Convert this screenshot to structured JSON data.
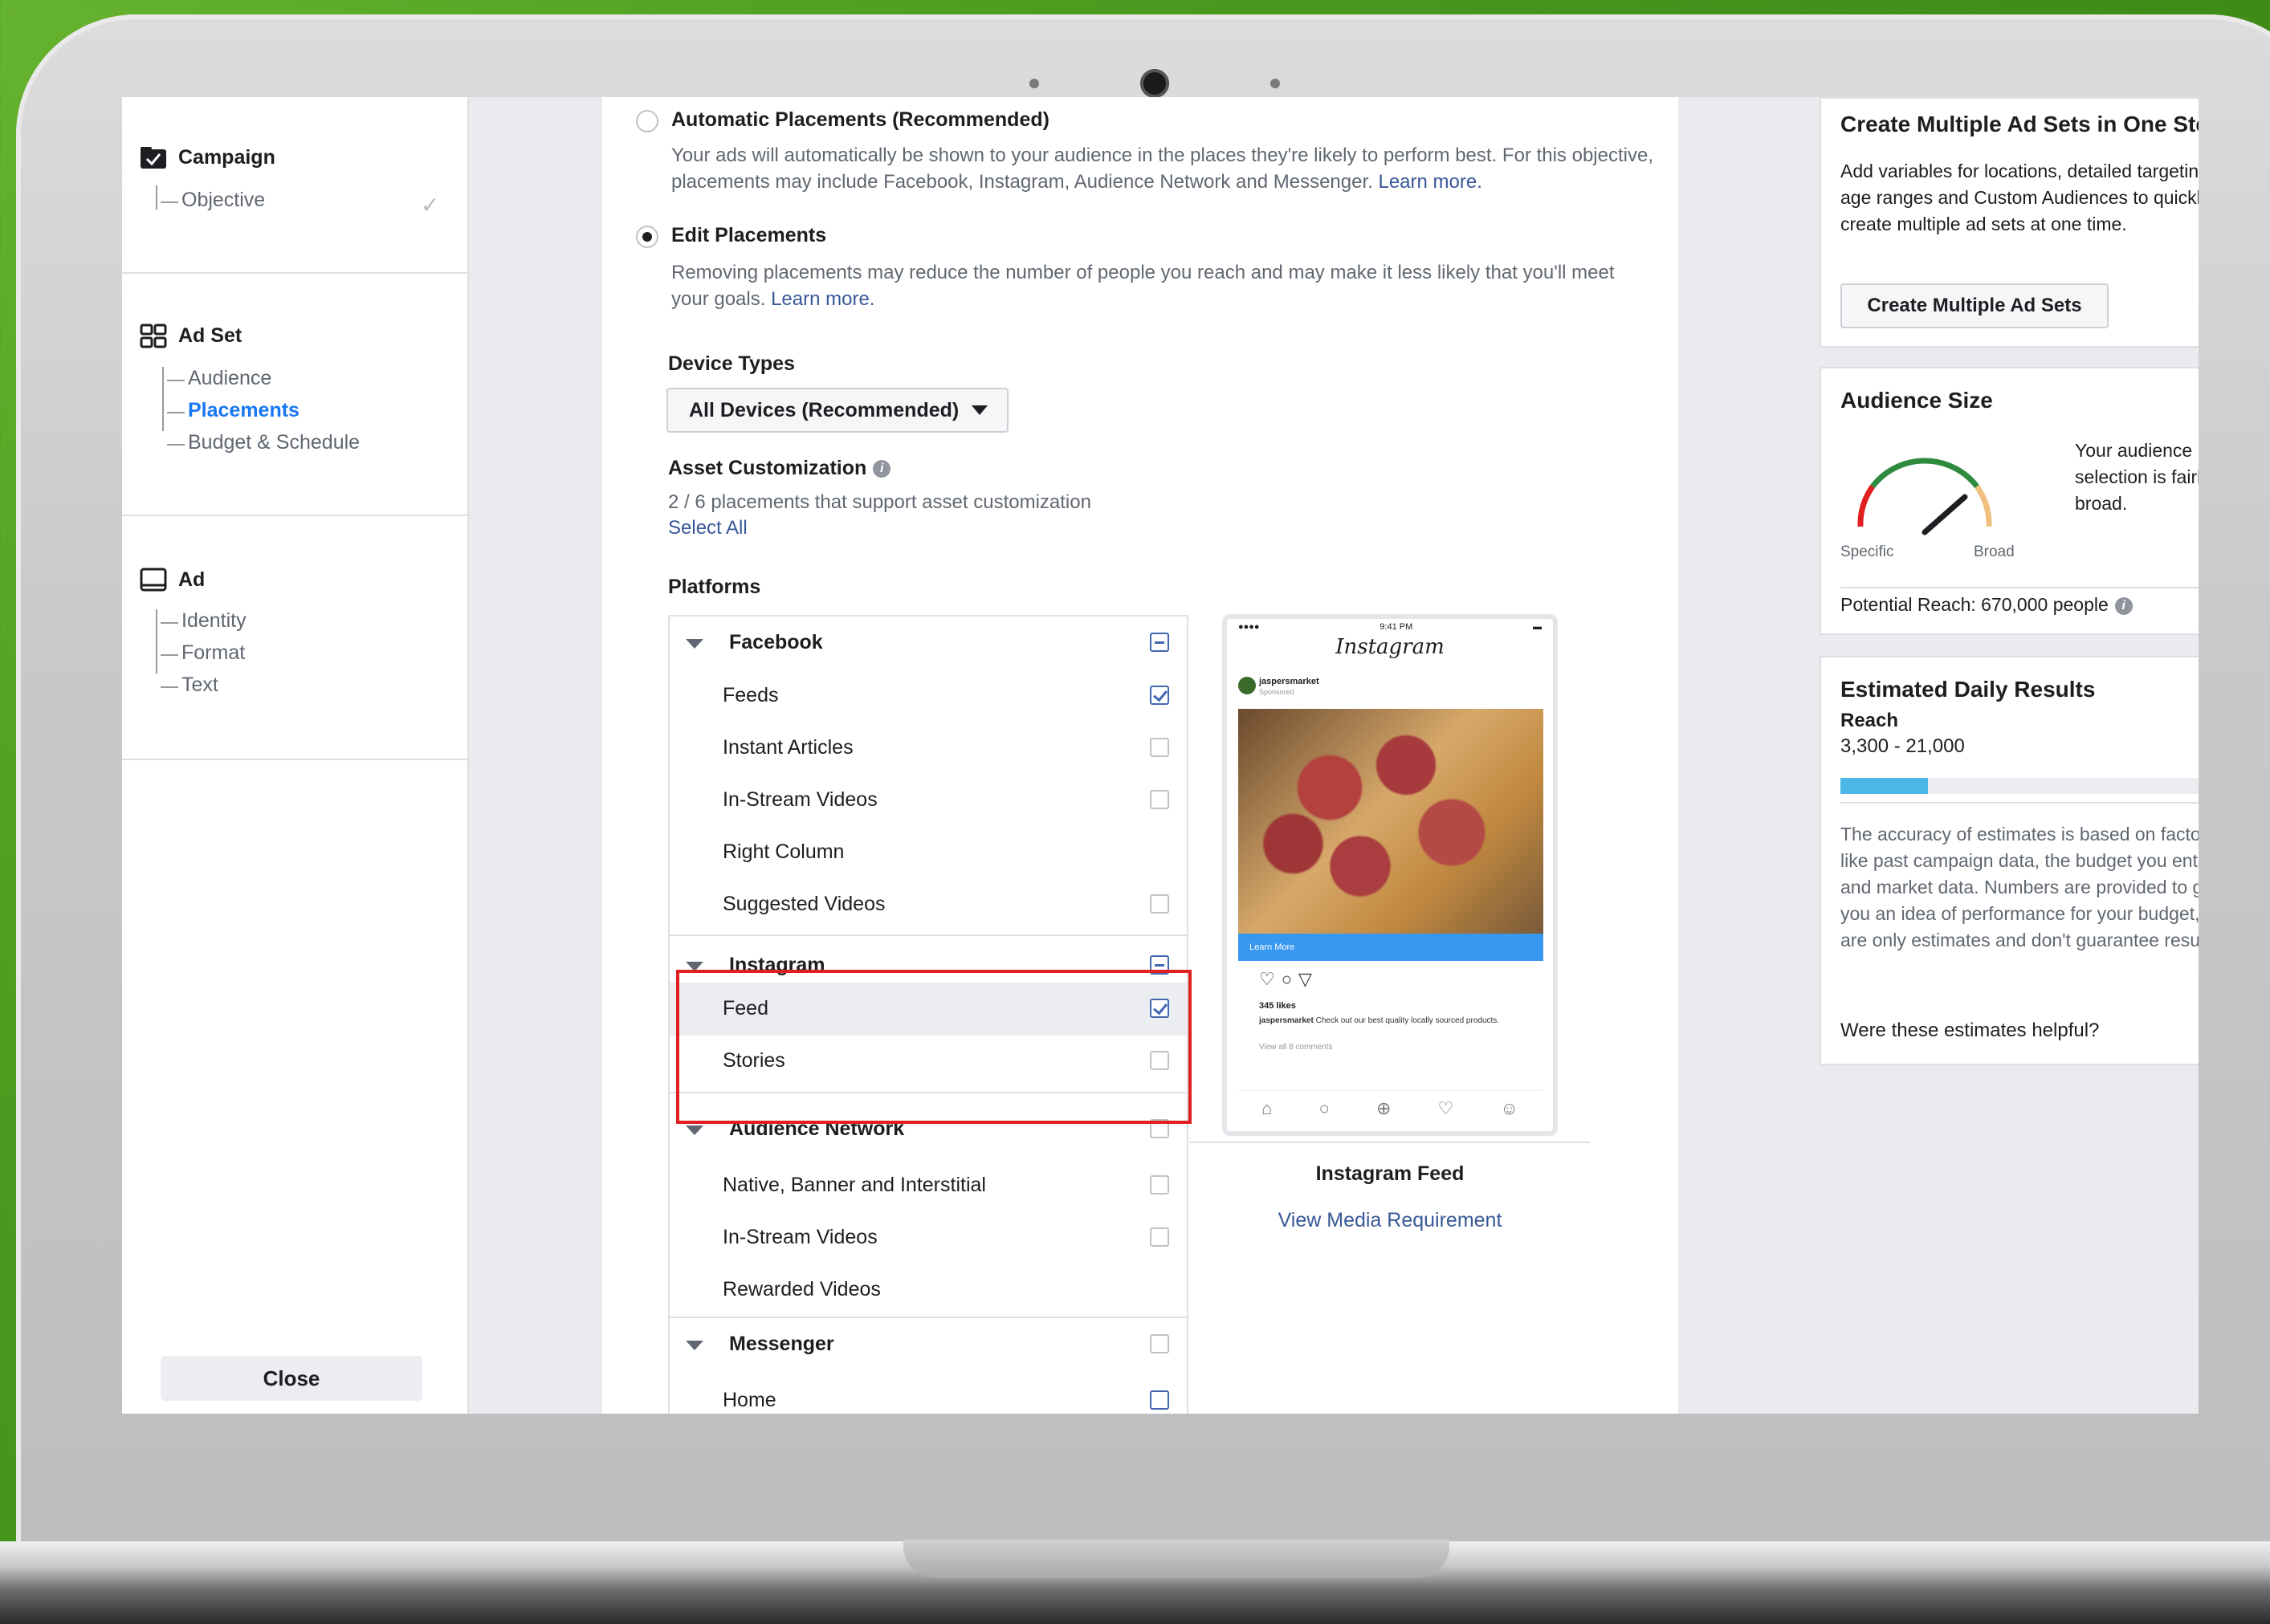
{
  "sidebar": {
    "campaign": {
      "title": "Campaign",
      "items": [
        "Objective"
      ]
    },
    "ad_set": {
      "title": "Ad Set",
      "items": [
        "Audience",
        "Placements",
        "Budget & Schedule"
      ],
      "active_index": 1
    },
    "ad": {
      "title": "Ad",
      "items": [
        "Identity",
        "Format",
        "Text"
      ]
    },
    "close_label": "Close"
  },
  "placements": {
    "automatic": {
      "label": "Automatic Placements (Recommended)",
      "desc": "Your ads will automatically be shown to your audience in the places they're likely to perform best. For this objective, placements may include Facebook, Instagram, Audience Network and Messenger.",
      "link": "Learn more."
    },
    "edit": {
      "label": "Edit Placements",
      "desc": "Removing placements may reduce the number of people you reach and may make it less likely that you'll meet your goals.",
      "link": "Learn more."
    },
    "selected": "edit",
    "device_types_label": "Device Types",
    "device_types_value": "All Devices (Recommended)",
    "asset_custom_label": "Asset Customization",
    "asset_custom_desc": "2 / 6 placements that support asset customization",
    "select_all": "Select All",
    "platforms_label": "Platforms"
  },
  "platforms": {
    "facebook": {
      "label": "Facebook",
      "items": [
        "Feeds",
        "Instant Articles",
        "In-Stream Videos",
        "Right Column",
        "Suggested Videos"
      ]
    },
    "instagram": {
      "label": "Instagram",
      "items": [
        "Feed",
        "Stories"
      ]
    },
    "audience_network": {
      "label": "Audience Network",
      "items": [
        "Native, Banner and Interstitial",
        "In-Stream Videos",
        "Rewarded Videos"
      ]
    },
    "messenger": {
      "label": "Messenger",
      "items": [
        "Home"
      ]
    }
  },
  "preview": {
    "status_time": "9:41 PM",
    "app": "Instagram",
    "user": "jaspersmarket",
    "sponsored": "Sponsored",
    "cta": "Learn More",
    "likes": "345 likes",
    "caption_user": "jaspersmarket",
    "caption": "Check out our best quality locally sourced products.",
    "comments": "View all 8 comments",
    "title": "Instagram Feed",
    "link": "View Media Requirement"
  },
  "right": {
    "multi": {
      "title": "Create Multiple Ad Sets in One Step",
      "desc": "Add variables for locations, detailed targeting, age ranges and Custom Audiences to quickly create multiple ad sets at one time.",
      "button": "Create Multiple Ad Sets"
    },
    "audience": {
      "title": "Audience Size",
      "desc": "Your audience selection is fairly broad.",
      "specific": "Specific",
      "broad": "Broad",
      "reach": "Potential Reach: 670,000 people"
    },
    "estimated": {
      "title": "Estimated Daily Results",
      "reach_label": "Reach",
      "reach_value": "3,300 - 21,000",
      "reach_fill": 0.22,
      "desc": "The accuracy of estimates is based on factors like past campaign data, the budget you entered and market data. Numbers are provided to give you an idea of performance for your budget, but are only estimates and don't guarantee results.",
      "link": "Were these estimates helpful?"
    }
  },
  "colors": {
    "accent": "#1877f2",
    "link": "#385898",
    "highlight": "#e02020",
    "bar": "#4db7e8"
  }
}
